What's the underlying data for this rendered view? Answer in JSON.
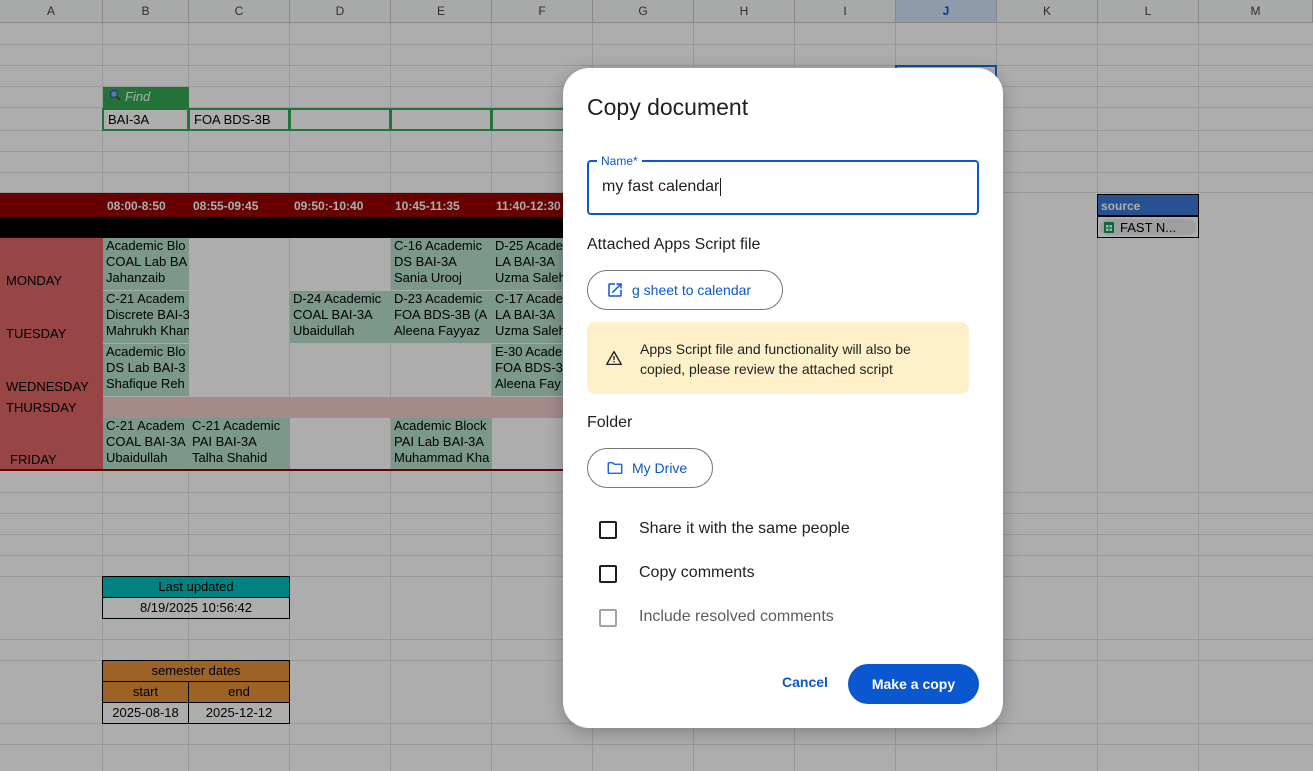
{
  "columns": [
    "A",
    "B",
    "C",
    "D",
    "E",
    "F",
    "G",
    "H",
    "I",
    "J",
    "K",
    "L",
    "M"
  ],
  "selected_column": "J",
  "find_button": {
    "label": "Find",
    "icon": "search-icon"
  },
  "filters": [
    "BAI-3A",
    "FOA BDS-3B",
    "",
    "",
    ""
  ],
  "time_slots": [
    "08:00-8:50",
    "08:55-09:45",
    "09:50:-10:40",
    "10:45-11:35",
    "11:40-12:30"
  ],
  "days": {
    "monday": "MONDAY",
    "tuesday": "TUESDAY",
    "wednesday": "WEDNESDAY",
    "thursday": "THURSDAY",
    "friday": "FRIDAY"
  },
  "classes": {
    "mon_b": [
      "Academic Blo",
      "COAL Lab BA",
      "Jahanzaib"
    ],
    "mon_e": [
      "C-16 Academic",
      "DS BAI-3A",
      "Sania Urooj"
    ],
    "mon_f": [
      "D-25 Acade",
      "LA BAI-3A",
      "Uzma Saleh"
    ],
    "tue_b": [
      "C-21 Academ",
      "Discrete BAI-3",
      "Mahrukh Khan"
    ],
    "tue_d": [
      "D-24 Academic",
      "COAL BAI-3A",
      "Ubaidullah"
    ],
    "tue_e": [
      "D-23 Academic",
      "FOA BDS-3B (A",
      "Aleena Fayyaz"
    ],
    "tue_f": [
      "C-17 Acade",
      "LA BAI-3A",
      "Uzma Saleh"
    ],
    "wed_b": [
      "Academic Blo",
      "DS Lab BAI-3",
      "Shafique Reh"
    ],
    "wed_f": [
      "E-30 Acade",
      "FOA BDS-3",
      "Aleena Fay"
    ],
    "fri_b": [
      "C-21 Academ",
      "COAL BAI-3A",
      "Ubaidullah"
    ],
    "fri_c": [
      "C-21 Academic",
      "PAI BAI-3A",
      "Talha Shahid"
    ],
    "fri_e": [
      "Academic Block",
      "PAI Lab BAI-3A",
      "Muhammad Kha"
    ]
  },
  "last_updated": {
    "label": "Last updated",
    "value": "8/19/2025 10:56:42"
  },
  "semester": {
    "title": "semester dates",
    "start_label": "start",
    "end_label": "end",
    "start": "2025-08-18",
    "end": "2025-12-12"
  },
  "source": {
    "header": "source",
    "chip": "FAST N..."
  },
  "dialog": {
    "title": "Copy document",
    "name_label": "Name*",
    "name_value": "my fast calendar",
    "script_section": "Attached Apps Script file",
    "script_link": "g sheet to calendar",
    "warning": "Apps Script file and functionality will also be copied, please review the attached script",
    "folder_section": "Folder",
    "folder": "My Drive",
    "options": [
      {
        "label": "Share it with the same people",
        "checked": false
      },
      {
        "label": "Copy comments",
        "checked": false
      },
      {
        "label": "Include resolved comments",
        "checked": false,
        "disabled": true
      }
    ],
    "cancel": "Cancel",
    "confirm": "Make a copy"
  },
  "colors": {
    "accent": "#0b57d0",
    "warning_bg": "#fef1c9",
    "day_red": "#e06666",
    "class_green": "#b7e1cd",
    "header_red": "#990000"
  }
}
